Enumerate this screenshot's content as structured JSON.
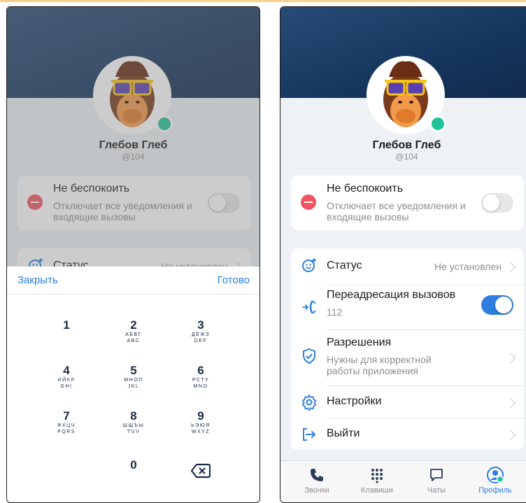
{
  "profile": {
    "name": "Глебов Глеб",
    "handle": "@104"
  },
  "dnd": {
    "title": "Не беспокоить",
    "subtitle": "Отключает все уведомления и входящие вызовы",
    "enabled": false
  },
  "menu": {
    "status": {
      "label": "Статус",
      "value": "Не установлен"
    },
    "forwarding": {
      "label": "Переадресация вызовов",
      "number": "112",
      "enabled": true
    },
    "permissions": {
      "label": "Разрешения",
      "subtitle": "Нужны для корректной работы приложения"
    },
    "settings": {
      "label": "Настройки"
    },
    "logout": {
      "label": "Выйти"
    }
  },
  "tabbar": {
    "calls": "Звонки",
    "keypad": "Клавиши",
    "chats": "Чаты",
    "profile": "Профиль",
    "active": "profile"
  },
  "picker": {
    "close_label": "Закрыть",
    "done_label": "Готово",
    "keys": [
      {
        "digit": "1",
        "cyr": "",
        "lat": ""
      },
      {
        "digit": "2",
        "cyr": "АБВГ",
        "lat": "ABC"
      },
      {
        "digit": "3",
        "cyr": "ДЕЖЗ",
        "lat": "DEF"
      },
      {
        "digit": "4",
        "cyr": "ИЙКЛ",
        "lat": "GHI"
      },
      {
        "digit": "5",
        "cyr": "МНОП",
        "lat": "JKL"
      },
      {
        "digit": "6",
        "cyr": "РСТУ",
        "lat": "MNO"
      },
      {
        "digit": "7",
        "cyr": "ФХЦЧ",
        "lat": "PQRS"
      },
      {
        "digit": "8",
        "cyr": "ШЩЪЫ",
        "lat": "TUV"
      },
      {
        "digit": "9",
        "cyr": "ЬЭЮЯ",
        "lat": "WXYZ"
      },
      {
        "digit": "0",
        "cyr": "",
        "lat": ""
      }
    ]
  },
  "colors": {
    "accent": "#2d7ee0",
    "online": "#22c39a",
    "dnd_icon": "#ef5460",
    "hero": "#1b3d66"
  },
  "icons": {
    "dnd": "minus-circle-icon",
    "status": "smiley-plus-icon",
    "forwarding": "phone-forward-icon",
    "permissions": "shield-check-icon",
    "settings": "gear-icon",
    "logout": "logout-icon",
    "backspace": "backspace-icon"
  }
}
